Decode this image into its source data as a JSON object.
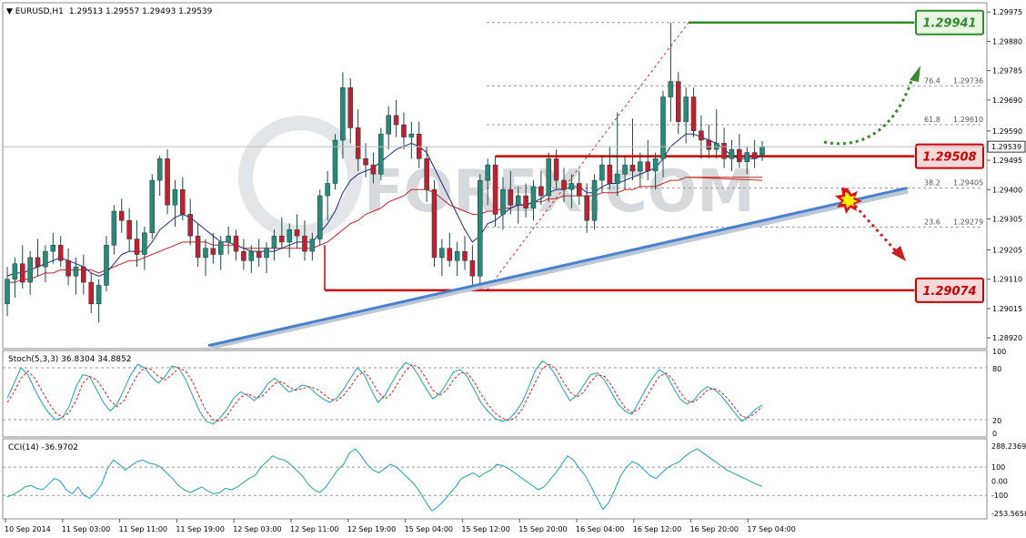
{
  "header": {
    "symbol_label": "EURUSD,H1",
    "ohlc_text": "1.29513 1.29557 1.29493 1.29539"
  },
  "main_price_axis": {
    "ticks": [
      1.29975,
      1.2988,
      1.29785,
      1.2969,
      1.2959,
      1.29495,
      1.294,
      1.29305,
      1.29205,
      1.2911,
      1.29015,
      1.2892
    ],
    "labels": [
      "1.29975",
      "1.29880",
      "1.29785",
      "1.29690",
      "1.29590",
      "1.29495",
      "1.29400",
      "1.29305",
      "1.29205",
      "1.29110",
      "1.29015",
      "1.28920"
    ],
    "min": 1.28885,
    "max": 1.30005,
    "current_price_label": "1.29539",
    "current_price": 1.29539
  },
  "horizontal_levels": [
    {
      "label": "1.29941",
      "value": 1.29941,
      "color": "#2e8b2e"
    },
    {
      "label": "1.29508",
      "value": 1.29508,
      "color": "#cc0000"
    },
    {
      "label": "1.29074",
      "value": 1.29074,
      "color": "#cc0000"
    }
  ],
  "fibonacci_levels": [
    {
      "ratio": "76.4",
      "price": "1.29736",
      "value": 1.29736
    },
    {
      "ratio": "61.8",
      "price": "1.29610",
      "value": 1.2961
    },
    {
      "ratio": "38.2",
      "price": "1.29405",
      "value": 1.29405
    },
    {
      "ratio": "23.6",
      "price": "1.29279",
      "value": 1.29279
    }
  ],
  "watermark": "FOREX.COM",
  "time_axis": {
    "labels": [
      "10 Sep 2014",
      "11 Sep 03:00",
      "11 Sep 11:00",
      "11 Sep 19:00",
      "12 Sep 03:00",
      "12 Sep 11:00",
      "12 Sep 19:00",
      "15 Sep 04:00",
      "15 Sep 12:00",
      "15 Sep 20:00",
      "16 Sep 04:00",
      "16 Sep 12:00",
      "16 Sep 20:00",
      "17 Sep 04:00"
    ]
  },
  "stoch_panel": {
    "title": "Stoch(5,3,3) 36.8304 34.8852",
    "levels": [
      "80",
      "20"
    ],
    "axis_labels": [
      "100",
      "80",
      "20",
      "0"
    ],
    "main_values": [
      45,
      62,
      80,
      72,
      55,
      40,
      28,
      20,
      22,
      35,
      58,
      72,
      70,
      55,
      40,
      30,
      38,
      55,
      72,
      84,
      80,
      70,
      62,
      70,
      82,
      80,
      66,
      48,
      30,
      18,
      15,
      22,
      32,
      45,
      52,
      48,
      42,
      50,
      62,
      68,
      60,
      52,
      55,
      60,
      58,
      50,
      44,
      40,
      45,
      55,
      68,
      80,
      72,
      55,
      40,
      48,
      62,
      76,
      86,
      82,
      70,
      56,
      44,
      50,
      62,
      75,
      78,
      70,
      55,
      40,
      30,
      22,
      18,
      20,
      28,
      40,
      58,
      78,
      88,
      82,
      70,
      55,
      42,
      48,
      60,
      72,
      74,
      66,
      52,
      38,
      30,
      26,
      40,
      55,
      68,
      78,
      72,
      58,
      44,
      38,
      42,
      52,
      58,
      55,
      48,
      38,
      28,
      18,
      24,
      32,
      36.83
    ],
    "signal_values": [
      40,
      52,
      68,
      76,
      68,
      54,
      40,
      28,
      23,
      28,
      42,
      62,
      70,
      66,
      55,
      42,
      35,
      42,
      58,
      72,
      80,
      78,
      70,
      66,
      72,
      80,
      76,
      64,
      46,
      30,
      20,
      18,
      24,
      36,
      46,
      50,
      46,
      46,
      54,
      62,
      64,
      58,
      54,
      56,
      58,
      56,
      50,
      44,
      42,
      48,
      58,
      70,
      76,
      66,
      52,
      44,
      50,
      64,
      76,
      84,
      80,
      68,
      54,
      48,
      54,
      66,
      74,
      74,
      64,
      50,
      38,
      28,
      22,
      19,
      22,
      32,
      48,
      64,
      80,
      84,
      78,
      64,
      52,
      46,
      52,
      64,
      72,
      70,
      60,
      46,
      34,
      28,
      32,
      44,
      58,
      70,
      74,
      66,
      52,
      42,
      40,
      46,
      54,
      56,
      52,
      44,
      34,
      24,
      22,
      28,
      34.89
    ]
  },
  "cci_panel": {
    "title": "CCI(14) -36.9702",
    "axis_labels": [
      "288.2369",
      "100",
      "0.00",
      "-100",
      "-253.5658"
    ],
    "min": -253.5658,
    "max": 288.2369,
    "values": [
      -110,
      -95,
      -70,
      -40,
      -30,
      -50,
      -60,
      -20,
      20,
      0,
      -60,
      -90,
      -40,
      -100,
      -120,
      -80,
      -20,
      90,
      150,
      120,
      80,
      110,
      140,
      150,
      130,
      120,
      100,
      60,
      20,
      -30,
      -60,
      -80,
      -60,
      -40,
      -70,
      -90,
      -80,
      -50,
      -60,
      -40,
      -10,
      20,
      40,
      100,
      140,
      180,
      160,
      150,
      120,
      80,
      40,
      -20,
      -60,
      -80,
      -40,
      20,
      80,
      120,
      200,
      230,
      180,
      120,
      80,
      60,
      90,
      120,
      100,
      60,
      20,
      -20,
      -80,
      -150,
      -210,
      -180,
      -140,
      -90,
      -40,
      20,
      40,
      60,
      30,
      60,
      80,
      120,
      110,
      90,
      60,
      30,
      0,
      -30,
      -60,
      -40,
      10,
      60,
      120,
      180,
      150,
      90,
      40,
      -40,
      -120,
      -200,
      -150,
      -60,
      40,
      100,
      140,
      120,
      80,
      40,
      20,
      60,
      100,
      120,
      140,
      180,
      210,
      230,
      200,
      170,
      140,
      110,
      80,
      60,
      40,
      20,
      0,
      -20,
      -36.97
    ]
  },
  "chart_data": {
    "type": "candlestick",
    "timeframe": "H1",
    "y_range": [
      1.28885,
      1.30005
    ],
    "ohlc": [
      [
        1.2903,
        1.2915,
        1.2899,
        1.2911
      ],
      [
        1.2911,
        1.2918,
        1.2905,
        1.2916
      ],
      [
        1.2916,
        1.2922,
        1.2908,
        1.291
      ],
      [
        1.291,
        1.292,
        1.2906,
        1.2918
      ],
      [
        1.2918,
        1.2924,
        1.2912,
        1.2915
      ],
      [
        1.2915,
        1.2922,
        1.291,
        1.292
      ],
      [
        1.292,
        1.2926,
        1.2916,
        1.2922
      ],
      [
        1.2922,
        1.2925,
        1.2915,
        1.2917
      ],
      [
        1.2917,
        1.2921,
        1.2909,
        1.2912
      ],
      [
        1.2912,
        1.2918,
        1.2906,
        1.2915
      ],
      [
        1.2915,
        1.2919,
        1.2906,
        1.291
      ],
      [
        1.291,
        1.2913,
        1.29,
        1.2903
      ],
      [
        1.2903,
        1.2911,
        1.2897,
        1.2909
      ],
      [
        1.2909,
        1.2925,
        1.2907,
        1.2922
      ],
      [
        1.2922,
        1.2935,
        1.2919,
        1.2933
      ],
      [
        1.2933,
        1.2937,
        1.2926,
        1.293
      ],
      [
        1.293,
        1.2934,
        1.292,
        1.2924
      ],
      [
        1.2924,
        1.293,
        1.2915,
        1.2919
      ],
      [
        1.2919,
        1.2928,
        1.2914,
        1.2926
      ],
      [
        1.2926,
        1.2945,
        1.2924,
        1.2943
      ],
      [
        1.2943,
        1.2951,
        1.2938,
        1.295
      ],
      [
        1.295,
        1.2953,
        1.2932,
        1.2935
      ],
      [
        1.2935,
        1.2943,
        1.2928,
        1.294
      ],
      [
        1.294,
        1.2944,
        1.293,
        1.2932
      ],
      [
        1.2932,
        1.2937,
        1.2922,
        1.2925
      ],
      [
        1.2925,
        1.2929,
        1.2915,
        1.2918
      ],
      [
        1.2918,
        1.2924,
        1.2912,
        1.2921
      ],
      [
        1.2921,
        1.2926,
        1.2916,
        1.2919
      ],
      [
        1.2919,
        1.2925,
        1.2914,
        1.2923
      ],
      [
        1.2923,
        1.2928,
        1.2919,
        1.2925
      ],
      [
        1.2925,
        1.2927,
        1.2917,
        1.292
      ],
      [
        1.292,
        1.2924,
        1.2914,
        1.2917
      ],
      [
        1.2917,
        1.2922,
        1.2913,
        1.292
      ],
      [
        1.292,
        1.2924,
        1.2915,
        1.2918
      ],
      [
        1.2918,
        1.2923,
        1.2913,
        1.2921
      ],
      [
        1.2921,
        1.2927,
        1.2917,
        1.2925
      ],
      [
        1.2925,
        1.2931,
        1.2921,
        1.2923
      ],
      [
        1.2923,
        1.2929,
        1.2918,
        1.2927
      ],
      [
        1.2927,
        1.2932,
        1.2921,
        1.2925
      ],
      [
        1.2925,
        1.293,
        1.2917,
        1.292
      ],
      [
        1.292,
        1.2926,
        1.2917,
        1.2924
      ],
      [
        1.2924,
        1.294,
        1.2922,
        1.2938
      ],
      [
        1.2938,
        1.2946,
        1.293,
        1.2942
      ],
      [
        1.2942,
        1.2958,
        1.294,
        1.2956
      ],
      [
        1.2956,
        1.2978,
        1.295,
        1.2973
      ],
      [
        1.2973,
        1.2976,
        1.2955,
        1.296
      ],
      [
        1.296,
        1.2966,
        1.2946,
        1.295
      ],
      [
        1.295,
        1.2955,
        1.2944,
        1.2948
      ],
      [
        1.2948,
        1.2952,
        1.2942,
        1.2945
      ],
      [
        1.2945,
        1.296,
        1.2943,
        1.2958
      ],
      [
        1.2958,
        1.2967,
        1.2953,
        1.2964
      ],
      [
        1.2964,
        1.2969,
        1.2957,
        1.2961
      ],
      [
        1.2961,
        1.2965,
        1.2953,
        1.2957
      ],
      [
        1.2957,
        1.2962,
        1.295,
        1.2958
      ],
      [
        1.2958,
        1.2962,
        1.2947,
        1.295
      ],
      [
        1.295,
        1.2954,
        1.2936,
        1.294
      ],
      [
        1.294,
        1.2943,
        1.2915,
        1.2918
      ],
      [
        1.2918,
        1.2924,
        1.2912,
        1.2921
      ],
      [
        1.2921,
        1.2926,
        1.2915,
        1.2917
      ],
      [
        1.2917,
        1.2923,
        1.2912,
        1.292
      ],
      [
        1.292,
        1.2925,
        1.2914,
        1.2917
      ],
      [
        1.2917,
        1.2922,
        1.2908,
        1.2912
      ],
      [
        1.2912,
        1.2945,
        1.2908,
        1.2943
      ],
      [
        1.2943,
        1.295,
        1.2935,
        1.2948
      ],
      [
        1.2948,
        1.2951,
        1.2928,
        1.2932
      ],
      [
        1.2932,
        1.2944,
        1.2927,
        1.294
      ],
      [
        1.294,
        1.2946,
        1.2932,
        1.2935
      ],
      [
        1.2935,
        1.2941,
        1.2929,
        1.2938
      ],
      [
        1.2938,
        1.2942,
        1.2931,
        1.2934
      ],
      [
        1.2934,
        1.2943,
        1.293,
        1.2941
      ],
      [
        1.2941,
        1.2946,
        1.2935,
        1.2938
      ],
      [
        1.2938,
        1.2952,
        1.2936,
        1.295
      ],
      [
        1.295,
        1.2953,
        1.294,
        1.2943
      ],
      [
        1.2943,
        1.2947,
        1.2936,
        1.294
      ],
      [
        1.294,
        1.2945,
        1.2934,
        1.2942
      ],
      [
        1.2942,
        1.2946,
        1.2935,
        1.2938
      ],
      [
        1.2938,
        1.2942,
        1.2926,
        1.293
      ],
      [
        1.293,
        1.2945,
        1.2927,
        1.2943
      ],
      [
        1.2943,
        1.2951,
        1.2939,
        1.2948
      ],
      [
        1.2948,
        1.2954,
        1.294,
        1.2942
      ],
      [
        1.2942,
        1.2965,
        1.2938,
        1.2945
      ],
      [
        1.2945,
        1.2951,
        1.294,
        1.2948
      ],
      [
        1.2948,
        1.2963,
        1.2943,
        1.2946
      ],
      [
        1.2946,
        1.2952,
        1.2941,
        1.2949
      ],
      [
        1.2949,
        1.2956,
        1.2943,
        1.2946
      ],
      [
        1.2946,
        1.2952,
        1.294,
        1.295
      ],
      [
        1.295,
        1.2972,
        1.2944,
        1.297
      ],
      [
        1.297,
        1.2994,
        1.2962,
        1.2975
      ],
      [
        1.2975,
        1.2978,
        1.2958,
        1.2962
      ],
      [
        1.2962,
        1.2973,
        1.2955,
        1.297
      ],
      [
        1.297,
        1.2973,
        1.2957,
        1.2959
      ],
      [
        1.2959,
        1.2964,
        1.295,
        1.2956
      ],
      [
        1.2956,
        1.2961,
        1.295,
        1.2953
      ],
      [
        1.2953,
        1.2966,
        1.295,
        1.2955
      ],
      [
        1.2955,
        1.296,
        1.2947,
        1.295
      ],
      [
        1.295,
        1.2956,
        1.2946,
        1.2953
      ],
      [
        1.2953,
        1.2958,
        1.2947,
        1.2949
      ],
      [
        1.2949,
        1.2954,
        1.2945,
        1.2952
      ],
      [
        1.2952,
        1.2956,
        1.2947,
        1.295
      ],
      [
        1.29513,
        1.29557,
        1.29493,
        1.29539
      ]
    ],
    "ma_fast": [
      1.2912,
      1.2913,
      1.2913,
      1.2914,
      1.2915,
      1.2916,
      1.2917,
      1.2918,
      1.2917,
      1.2916,
      1.2915,
      1.2913,
      1.2912,
      1.2913,
      1.2916,
      1.2919,
      1.292,
      1.292,
      1.292,
      1.2923,
      1.2927,
      1.2929,
      1.2931,
      1.2932,
      1.2931,
      1.2929,
      1.2927,
      1.2925,
      1.2923,
      1.2923,
      1.2922,
      1.2921,
      1.292,
      1.292,
      1.292,
      1.292,
      1.2921,
      1.2922,
      1.2923,
      1.2923,
      1.2923,
      1.2926,
      1.2929,
      1.2933,
      1.2939,
      1.2943,
      1.2945,
      1.2946,
      1.2947,
      1.2949,
      1.2951,
      1.2953,
      1.2954,
      1.2955,
      1.2954,
      1.2952,
      1.2947,
      1.2942,
      1.2937,
      1.2932,
      1.2927,
      1.2923,
      1.2925,
      1.2929,
      1.293,
      1.2932,
      1.2934,
      1.2935,
      1.2935,
      1.2936,
      1.2937,
      1.2939,
      1.294,
      1.294,
      1.2941,
      1.2941,
      1.2939,
      1.2939,
      1.2941,
      1.2942,
      1.2942,
      1.2943,
      1.2944,
      1.2945,
      1.2946,
      1.2947,
      1.295,
      1.2954,
      1.2956,
      1.2958,
      1.2958,
      1.2957,
      1.2956,
      1.2955,
      1.2953,
      1.2951,
      1.295,
      1.295,
      1.295,
      1.2951
    ],
    "ma_slow": [
      1.291,
      1.291,
      1.2911,
      1.2911,
      1.2912,
      1.2913,
      1.2913,
      1.2914,
      1.2914,
      1.2914,
      1.2914,
      1.2914,
      1.2913,
      1.2914,
      1.2915,
      1.2916,
      1.2917,
      1.2917,
      1.2918,
      1.2919,
      1.292,
      1.2921,
      1.2922,
      1.2923,
      1.2923,
      1.2923,
      1.2923,
      1.2922,
      1.2922,
      1.2922,
      1.2922,
      1.2921,
      1.2921,
      1.2921,
      1.2921,
      1.2921,
      1.2921,
      1.2921,
      1.2921,
      1.2921,
      1.2921,
      1.2922,
      1.2923,
      1.2925,
      1.2927,
      1.2929,
      1.293,
      1.2932,
      1.2933,
      1.2934,
      1.2936,
      1.2937,
      1.2938,
      1.294,
      1.294,
      1.294,
      1.2939,
      1.2937,
      1.2935,
      1.2934,
      1.2933,
      1.2932,
      1.2932,
      1.2933,
      1.2933,
      1.2934,
      1.2934,
      1.2935,
      1.2935,
      1.2936,
      1.2936,
      1.2937,
      1.2937,
      1.2938,
      1.2938,
      1.2938,
      1.2938,
      1.2938,
      1.2939,
      1.2939,
      1.2939,
      1.294,
      1.294,
      1.2941,
      1.2941,
      1.2941,
      1.2942,
      1.2943,
      1.2943,
      1.2944,
      1.2944,
      1.2944,
      1.2944,
      1.2944,
      1.2944,
      1.2944,
      1.2944,
      1.2944,
      1.2944,
      1.2944
    ]
  },
  "colors": {
    "bull": "#2a8a7a",
    "bear": "#c22030",
    "ma_fast": "#1a2a8a",
    "ma_slow": "#cc2222",
    "trendline": "#4a80d0",
    "stoch_main": "#1aa0b8",
    "cci": "#1aa0b8",
    "resistance_label_bg": "#e8f5e0",
    "support_label_bg": "#f8d8d8"
  }
}
